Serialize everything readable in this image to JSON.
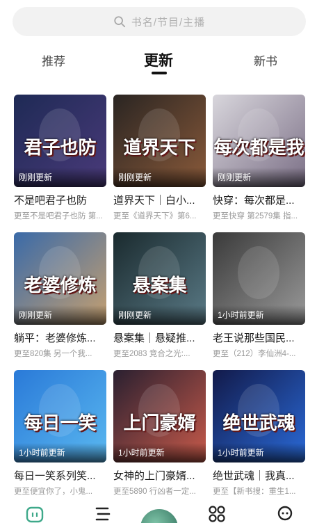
{
  "search": {
    "placeholder": "书名/节目/主播"
  },
  "tabs": [
    {
      "label": "推荐",
      "active": false
    },
    {
      "label": "更新",
      "active": true
    },
    {
      "label": "新书",
      "active": false
    }
  ],
  "books": [
    {
      "title": "不是吧君子也防",
      "subtitle": "更至不是吧君子也防 第...",
      "badge": "刚刚更新",
      "cover_text": "君子也防",
      "colors": [
        "#1e2a55",
        "#4a3a7a"
      ]
    },
    {
      "title": "道界天下｜白小...",
      "subtitle": "更至《道界天下》第6...",
      "badge": "刚刚更新",
      "cover_text": "道界天下",
      "colors": [
        "#2a2522",
        "#8a5a3a"
      ]
    },
    {
      "title": "快穿：每次都是...",
      "subtitle": "更至快穿 第2579集 指...",
      "badge": "刚刚更新",
      "cover_text": "每次都是我",
      "colors": [
        "#d8d6dc",
        "#7b6f86"
      ]
    },
    {
      "title": "躺平：老婆修炼...",
      "subtitle": "更至820集 另一个我...",
      "badge": "刚刚更新",
      "cover_text": "老婆修炼",
      "colors": [
        "#3a6aa8",
        "#c6a070"
      ]
    },
    {
      "title": "悬案集｜悬疑推...",
      "subtitle": "更至2083 竞合之光:...",
      "badge": "刚刚更新",
      "cover_text": "悬案集",
      "colors": [
        "#1a2a2e",
        "#5a7a86"
      ]
    },
    {
      "title": "老王说那些国民...",
      "subtitle": "更至（212）李仙洲4-...",
      "badge": "1小时前更新",
      "cover_text": "",
      "colors": [
        "#3a3a3a",
        "#9a9a9a"
      ]
    },
    {
      "title": "每日一笑系列笑...",
      "subtitle": "更至便宜你了，小鬼...",
      "badge": "1小时前更新",
      "cover_text": "每日一笑",
      "colors": [
        "#2a7ad8",
        "#5ab8f0"
      ]
    },
    {
      "title": "女神的上门豪婿...",
      "subtitle": "更至5890 行凶者一定...",
      "badge": "1小时前更新",
      "cover_text": "上门豪婿",
      "colors": [
        "#2a2030",
        "#c85a4a"
      ]
    },
    {
      "title": "绝世武魂｜我真...",
      "subtitle": "更至【新书搜：重生1...",
      "badge": "1小时前更新",
      "cover_text": "绝世武魂",
      "colors": [
        "#121a4a",
        "#2a6ad8"
      ]
    }
  ],
  "accent_color": "#111111",
  "icons": [
    "search-icon",
    "home-icon",
    "list-icon",
    "play-center-icon",
    "grid-icon",
    "profile-icon"
  ]
}
